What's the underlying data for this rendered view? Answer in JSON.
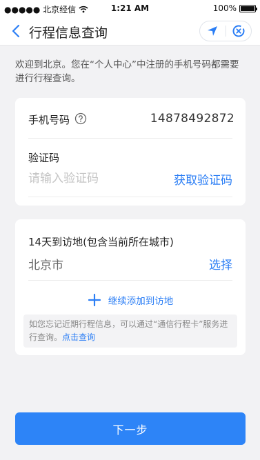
{
  "status_bar": {
    "carrier": "●●●●● 北京经信",
    "time": "1:21 AM",
    "battery": "100%",
    "battery_level": 1.0
  },
  "nav": {
    "title": "行程信息查询",
    "back_icon": "chevron-left-icon",
    "location_icon": "location-arrow-icon",
    "close_icon": "close-circle-icon"
  },
  "intro_text": "欢迎到北京。您在“个人中心”中注册的手机号码都需要进行行程查询。",
  "phone": {
    "label": "手机号码",
    "value": "14878492872"
  },
  "verification": {
    "label": "验证码",
    "placeholder": "请输入验证码",
    "get_code_label": "获取验证码"
  },
  "visits": {
    "title": "14天到访地(包含当前所在城市)",
    "city": "北京市",
    "select_label": "选择",
    "add_label": "继续添加到访地"
  },
  "tip": {
    "text": "如您忘记近期行程信息，可以通过“通信行程卡”服务进行查询。",
    "link": "点击查询"
  },
  "next_button": "下一步",
  "colors": {
    "accent": "#2b7ef5",
    "background": "#f2f2f4",
    "card": "#ffffff"
  }
}
